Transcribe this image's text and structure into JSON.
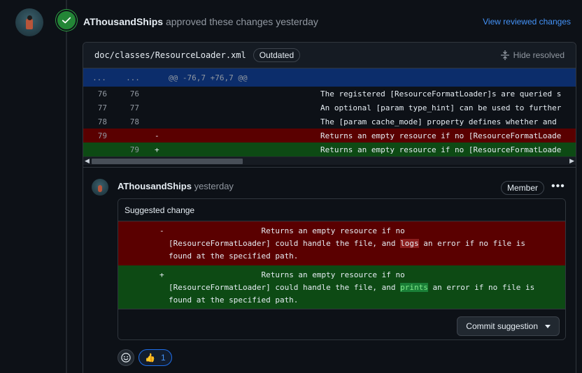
{
  "review": {
    "author": "AThousandShips",
    "action": "approved these changes yesterday",
    "view_link": "View reviewed changes"
  },
  "file": {
    "path": "doc/classes/ResourceLoader.xml",
    "badge": "Outdated",
    "hide_resolved": "Hide resolved",
    "hunk": {
      "left": "...",
      "right": "...",
      "text": "@@ -76,7 +76,7 @@"
    },
    "lines": [
      {
        "left": "76",
        "right": "76",
        "sign": "",
        "type": "context",
        "text": "The registered [ResourceFormatLoader]s are queried s"
      },
      {
        "left": "77",
        "right": "77",
        "sign": "",
        "type": "context",
        "text": "An optional [param type_hint] can be used to further"
      },
      {
        "left": "78",
        "right": "78",
        "sign": "",
        "type": "context",
        "text": "The [param cache_mode] property defines whether and"
      },
      {
        "left": "79",
        "right": "",
        "sign": "-",
        "type": "del",
        "text": "Returns an empty resource if no [ResourceFormatLoade"
      },
      {
        "left": "",
        "right": "79",
        "sign": "+",
        "type": "add",
        "text": "Returns an empty resource if no [ResourceFormatLoade"
      }
    ]
  },
  "comment": {
    "author": "AThousandShips",
    "time": "yesterday",
    "role": "Member",
    "suggestion": {
      "title": "Suggested change",
      "del_sign": "-",
      "del_before": "                    Returns an empty resource if no\n[ResourceFormatLoader] could handle the file, and ",
      "del_highlight": "logs",
      "del_after": " an error if no file is\nfound at the specified path.",
      "add_sign": "+",
      "add_before": "                    Returns an empty resource if no\n[ResourceFormatLoader] could handle the file, and ",
      "add_highlight": "prints",
      "add_after": " an error if no file is\nfound at the specified path.",
      "commit_label": "Commit suggestion"
    },
    "reactions": [
      {
        "emoji": "👍",
        "count": "1"
      }
    ]
  }
}
